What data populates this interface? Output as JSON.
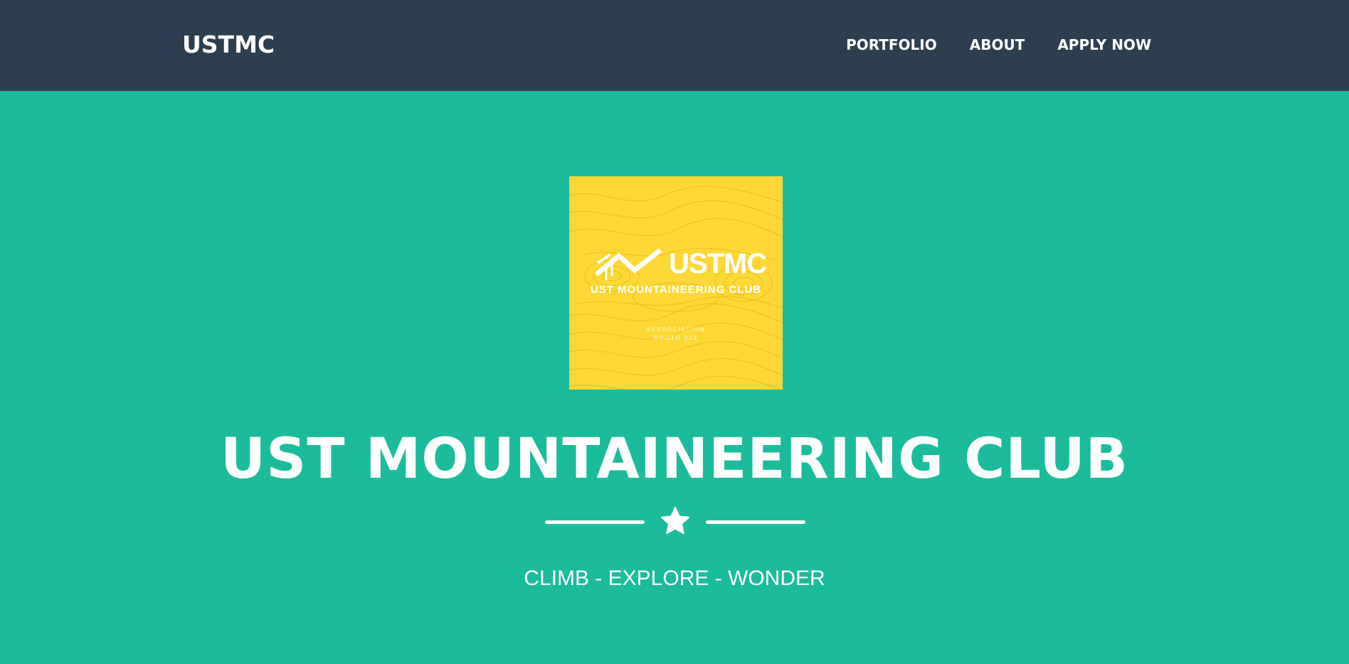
{
  "navbar": {
    "brand": "USTMC",
    "links": [
      {
        "label": "PORTFOLIO"
      },
      {
        "label": "ABOUT"
      },
      {
        "label": "APPLY NOW"
      }
    ],
    "background": "#2c3e50"
  },
  "masthead": {
    "background": "#1abc9c",
    "logo": {
      "wordmark": "USTMC",
      "subtitle": "UST MOUNTAINEERING CLUB",
      "small_text_line1": "#ASSOCIATION",
      "small_text_line2": "BOOTH 023",
      "background": "#fdd835",
      "icon": "mountain-ladder-icon"
    },
    "title": "UST MOUNTAINEERING CLUB",
    "divider_icon": "star-icon",
    "tagline": "CLIMB - EXPLORE - WONDER"
  }
}
